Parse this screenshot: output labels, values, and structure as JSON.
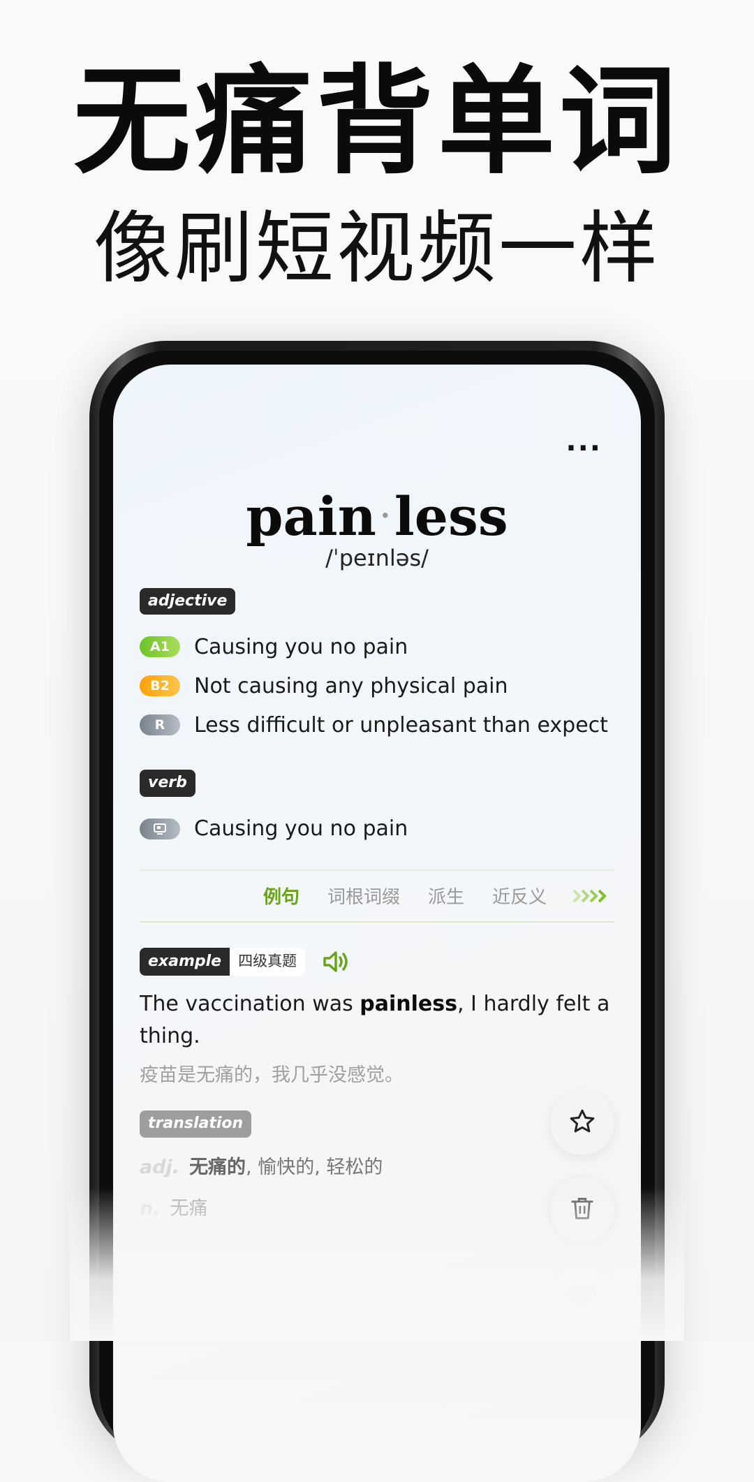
{
  "promo": {
    "headline": "无痛背单词",
    "subheadline": "像刷短视频一样"
  },
  "app": {
    "more_label": "···",
    "word": {
      "syllable_1": "pain",
      "separator": "·",
      "syllable_2": "less",
      "phonetic": "/ˈpeɪnləs/"
    },
    "adjective": {
      "tag": "adjective",
      "definitions": [
        {
          "level": "A1",
          "text": "Causing you no pain",
          "color": "#8fcf3c"
        },
        {
          "level": "B2",
          "text": "Not causing any physical pain",
          "color": "#ffb01e"
        },
        {
          "level": "R",
          "text": "Less difficult or unpleasant than expect",
          "color": "#8e969e"
        }
      ]
    },
    "verb": {
      "tag": "verb",
      "definitions": [
        {
          "icon": "screen-icon",
          "text": "Causing you no pain",
          "color": "#8e969e"
        }
      ]
    },
    "tabs": [
      {
        "label": "例句",
        "active": true
      },
      {
        "label": "词根词缀",
        "active": false
      },
      {
        "label": "派生",
        "active": false
      },
      {
        "label": "近反义",
        "active": false
      }
    ],
    "tabs_more_icon": "chevrons-right-icon",
    "example": {
      "tag": "example",
      "badge": "四级真题",
      "sentence_before": "The vaccination was ",
      "sentence_bold": "painless",
      "sentence_after": ", I hardly felt a thing.",
      "translation": "疫苗是无痛的，我几乎没感觉。"
    },
    "translation": {
      "tag": "translation",
      "rows": [
        {
          "pos": "adj.",
          "main": "无痛的",
          "rest": ", 愉快的, 轻松的"
        },
        {
          "pos": "n.",
          "main": "",
          "rest": "无痛"
        }
      ]
    },
    "fabs": [
      "star-icon",
      "trash-icon",
      "brain-icon"
    ],
    "colors": {
      "accent_green": "#6aa21b",
      "tag_dark": "#2a2a2a"
    }
  }
}
